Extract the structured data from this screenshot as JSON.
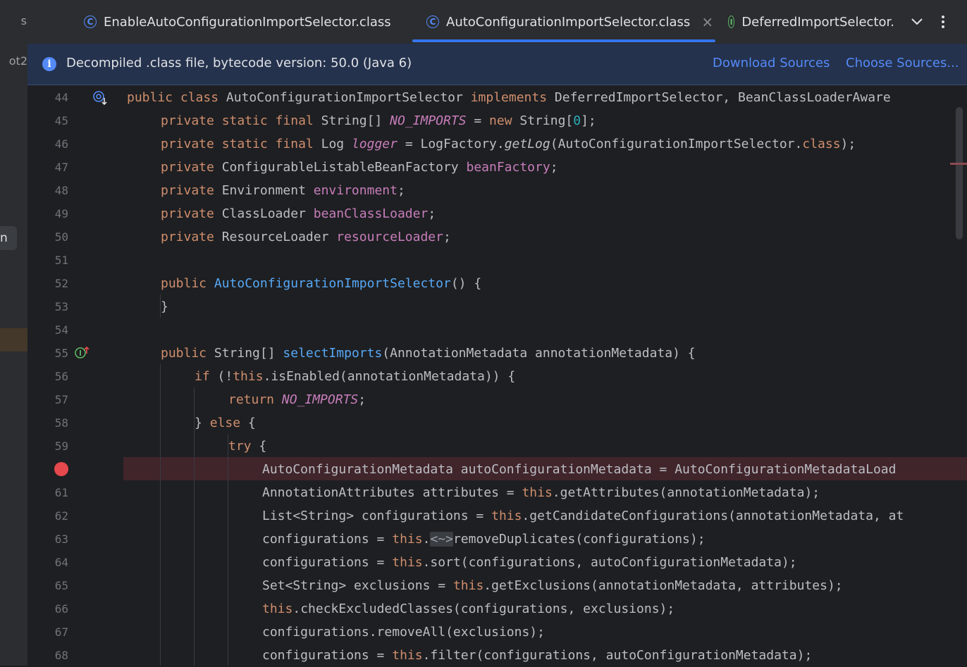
{
  "left_panel": {
    "fragment_top": "s",
    "fragment_project": "ot2",
    "fragment_chip": "n"
  },
  "tabs": [
    {
      "label": "EnableAutoConfigurationImportSelector.class",
      "icon": "class-icon",
      "active": false
    },
    {
      "label": "AutoConfigurationImportSelector.class",
      "icon": "class-icon",
      "active": true,
      "close": "×"
    },
    {
      "label": "DeferredImportSelector.",
      "icon": "interface-icon",
      "active": false
    }
  ],
  "tab_actions": {
    "more_tabs": "⌄",
    "menu": "⋮"
  },
  "infobar": {
    "message": "Decompiled .class file, bytecode version: 50.0 (Java 6)",
    "download_sources": "Download Sources",
    "choose_sources": "Choose Sources..."
  },
  "line_numbers": [
    "44",
    "45",
    "46",
    "47",
    "48",
    "49",
    "50",
    "51",
    "52",
    "53",
    "54",
    "55",
    "56",
    "57",
    "58",
    "59",
    "",
    "61",
    "62",
    "63",
    "64",
    "65",
    "66",
    "67",
    "68"
  ],
  "breakpoint_line": "60",
  "colors": {
    "keyword": "#cf8e6d",
    "field": "#c77dbb",
    "method": "#56a8f5",
    "number": "#2aacb8",
    "text": "#bcbec4",
    "breakpoint": "#e5484d",
    "accent": "#3574f0"
  },
  "code": {
    "l44": [
      "public",
      " ",
      "class",
      " AutoConfigurationImportSelector ",
      "implements",
      " DeferredImportSelector, BeanClassLoaderAware"
    ],
    "l45": [
      "private",
      " ",
      "static",
      " ",
      "final",
      " String[] ",
      "NO_IMPORTS",
      " = ",
      "new",
      " String[",
      "0",
      "];"
    ],
    "l46": [
      "private",
      " ",
      "static",
      " ",
      "final",
      " Log ",
      "logger",
      " = LogFactory.",
      "getLog",
      "(AutoConfigurationImportSelector.",
      "class",
      ");"
    ],
    "l47": [
      "private",
      " ConfigurableListableBeanFactory ",
      "beanFactory",
      ";"
    ],
    "l48": [
      "private",
      " Environment ",
      "environment",
      ";"
    ],
    "l49": [
      "private",
      " ClassLoader ",
      "beanClassLoader",
      ";"
    ],
    "l50": [
      "private",
      " ResourceLoader ",
      "resourceLoader",
      ";"
    ],
    "l52": [
      "public",
      " ",
      "AutoConfigurationImportSelector",
      "() {"
    ],
    "l53": [
      "}"
    ],
    "l55": [
      "public",
      " String[] ",
      "selectImports",
      "(AnnotationMetadata annotationMetadata) {"
    ],
    "l56": [
      "if",
      " (!",
      "this",
      ".isEnabled(annotationMetadata)) {"
    ],
    "l57": [
      "return",
      " ",
      "NO_IMPORTS",
      ";"
    ],
    "l58": [
      "} ",
      "else",
      " {"
    ],
    "l59": [
      "try",
      " {"
    ],
    "l60": [
      "AutoConfigurationMetadata autoConfigurationMetadata = AutoConfigurationMetadataLoad"
    ],
    "l61": [
      "AnnotationAttributes attributes = ",
      "this",
      ".getAttributes(annotationMetadata);"
    ],
    "l62": [
      "List<String> configurations = ",
      "this",
      ".getCandidateConfigurations(annotationMetadata, at"
    ],
    "l63": [
      "configurations = ",
      "this",
      ".",
      "<~>",
      "removeDuplicates(configurations);"
    ],
    "l64": [
      "configurations = ",
      "this",
      ".sort(configurations, autoConfigurationMetadata);"
    ],
    "l65": [
      "Set<String> exclusions = ",
      "this",
      ".getExclusions(annotationMetadata, attributes);"
    ],
    "l66": [
      "this",
      ".checkExcludedClasses(configurations, exclusions);"
    ],
    "l67": [
      "configurations.removeAll(exclusions);"
    ],
    "l68": [
      "configurations = ",
      "this",
      ".filter(configurations, autoConfigurationMetadata);"
    ]
  }
}
